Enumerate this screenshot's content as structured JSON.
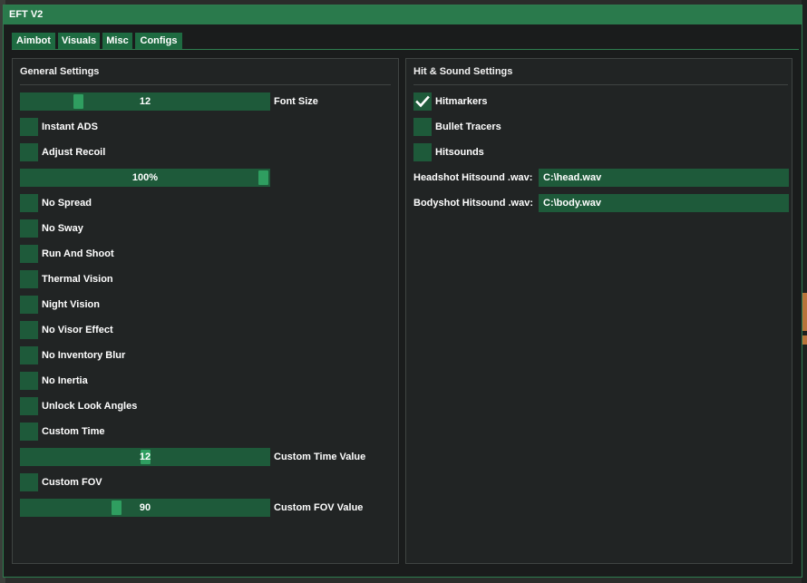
{
  "window": {
    "title": "EFT V2"
  },
  "tabs": [
    {
      "label": "Aimbot"
    },
    {
      "label": "Visuals"
    },
    {
      "label": "Misc"
    },
    {
      "label": "Configs"
    }
  ],
  "general": {
    "title": "General Settings",
    "font_size": {
      "value": "12",
      "label": "Font Size",
      "level": 0.22
    },
    "instant_ads": {
      "label": "Instant ADS",
      "checked": false
    },
    "adjust_recoil": {
      "label": "Adjust Recoil",
      "checked": false
    },
    "recoil_slider": {
      "value": "100%",
      "level": 1.0
    },
    "no_spread": {
      "label": "No Spread",
      "checked": false
    },
    "no_sway": {
      "label": "No Sway",
      "checked": false
    },
    "run_and_shoot": {
      "label": "Run And Shoot",
      "checked": false
    },
    "thermal_vision": {
      "label": "Thermal Vision",
      "checked": false
    },
    "night_vision": {
      "label": "Night Vision",
      "checked": false
    },
    "no_visor_effect": {
      "label": "No Visor Effect",
      "checked": false
    },
    "no_inventory_blur": {
      "label": "No Inventory Blur",
      "checked": false
    },
    "no_inertia": {
      "label": "No Inertia",
      "checked": false
    },
    "unlock_look_angles": {
      "label": "Unlock Look Angles",
      "checked": false
    },
    "custom_time": {
      "label": "Custom Time",
      "checked": false
    },
    "custom_time_value": {
      "value": "12",
      "label": "Custom Time Value",
      "level": 0.5
    },
    "custom_fov": {
      "label": "Custom FOV",
      "checked": false
    },
    "custom_fov_value": {
      "value": "90",
      "label": "Custom FOV Value",
      "level": 0.38
    }
  },
  "hit_sound": {
    "title": "Hit & Sound Settings",
    "hitmarkers": {
      "label": "Hitmarkers",
      "checked": true
    },
    "bullet_tracers": {
      "label": "Bullet Tracers",
      "checked": false
    },
    "hitsounds": {
      "label": "Hitsounds",
      "checked": false
    },
    "headshot": {
      "label": "Headshot Hitsound .wav:",
      "value": "C:\\head.wav"
    },
    "bodyshot": {
      "label": "Bodyshot Hitsound .wav:",
      "value": "C:\\body.wav"
    }
  },
  "icons": {
    "check": "checkmark-icon"
  },
  "colors": {
    "accent": "#2a7a4c",
    "control_bg": "#1e5a3a",
    "knob": "#2f9e60",
    "panel_bg": "#212424"
  }
}
